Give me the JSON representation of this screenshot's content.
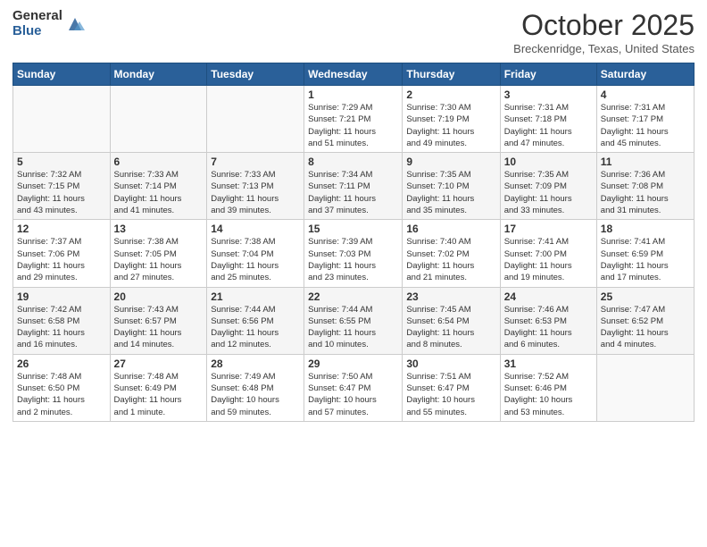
{
  "header": {
    "logo_general": "General",
    "logo_blue": "Blue",
    "month_title": "October 2025",
    "location": "Breckenridge, Texas, United States"
  },
  "days_of_week": [
    "Sunday",
    "Monday",
    "Tuesday",
    "Wednesday",
    "Thursday",
    "Friday",
    "Saturday"
  ],
  "weeks": [
    [
      {
        "day": "",
        "info": ""
      },
      {
        "day": "",
        "info": ""
      },
      {
        "day": "",
        "info": ""
      },
      {
        "day": "1",
        "info": "Sunrise: 7:29 AM\nSunset: 7:21 PM\nDaylight: 11 hours\nand 51 minutes."
      },
      {
        "day": "2",
        "info": "Sunrise: 7:30 AM\nSunset: 7:19 PM\nDaylight: 11 hours\nand 49 minutes."
      },
      {
        "day": "3",
        "info": "Sunrise: 7:31 AM\nSunset: 7:18 PM\nDaylight: 11 hours\nand 47 minutes."
      },
      {
        "day": "4",
        "info": "Sunrise: 7:31 AM\nSunset: 7:17 PM\nDaylight: 11 hours\nand 45 minutes."
      }
    ],
    [
      {
        "day": "5",
        "info": "Sunrise: 7:32 AM\nSunset: 7:15 PM\nDaylight: 11 hours\nand 43 minutes."
      },
      {
        "day": "6",
        "info": "Sunrise: 7:33 AM\nSunset: 7:14 PM\nDaylight: 11 hours\nand 41 minutes."
      },
      {
        "day": "7",
        "info": "Sunrise: 7:33 AM\nSunset: 7:13 PM\nDaylight: 11 hours\nand 39 minutes."
      },
      {
        "day": "8",
        "info": "Sunrise: 7:34 AM\nSunset: 7:11 PM\nDaylight: 11 hours\nand 37 minutes."
      },
      {
        "day": "9",
        "info": "Sunrise: 7:35 AM\nSunset: 7:10 PM\nDaylight: 11 hours\nand 35 minutes."
      },
      {
        "day": "10",
        "info": "Sunrise: 7:35 AM\nSunset: 7:09 PM\nDaylight: 11 hours\nand 33 minutes."
      },
      {
        "day": "11",
        "info": "Sunrise: 7:36 AM\nSunset: 7:08 PM\nDaylight: 11 hours\nand 31 minutes."
      }
    ],
    [
      {
        "day": "12",
        "info": "Sunrise: 7:37 AM\nSunset: 7:06 PM\nDaylight: 11 hours\nand 29 minutes."
      },
      {
        "day": "13",
        "info": "Sunrise: 7:38 AM\nSunset: 7:05 PM\nDaylight: 11 hours\nand 27 minutes."
      },
      {
        "day": "14",
        "info": "Sunrise: 7:38 AM\nSunset: 7:04 PM\nDaylight: 11 hours\nand 25 minutes."
      },
      {
        "day": "15",
        "info": "Sunrise: 7:39 AM\nSunset: 7:03 PM\nDaylight: 11 hours\nand 23 minutes."
      },
      {
        "day": "16",
        "info": "Sunrise: 7:40 AM\nSunset: 7:02 PM\nDaylight: 11 hours\nand 21 minutes."
      },
      {
        "day": "17",
        "info": "Sunrise: 7:41 AM\nSunset: 7:00 PM\nDaylight: 11 hours\nand 19 minutes."
      },
      {
        "day": "18",
        "info": "Sunrise: 7:41 AM\nSunset: 6:59 PM\nDaylight: 11 hours\nand 17 minutes."
      }
    ],
    [
      {
        "day": "19",
        "info": "Sunrise: 7:42 AM\nSunset: 6:58 PM\nDaylight: 11 hours\nand 16 minutes."
      },
      {
        "day": "20",
        "info": "Sunrise: 7:43 AM\nSunset: 6:57 PM\nDaylight: 11 hours\nand 14 minutes."
      },
      {
        "day": "21",
        "info": "Sunrise: 7:44 AM\nSunset: 6:56 PM\nDaylight: 11 hours\nand 12 minutes."
      },
      {
        "day": "22",
        "info": "Sunrise: 7:44 AM\nSunset: 6:55 PM\nDaylight: 11 hours\nand 10 minutes."
      },
      {
        "day": "23",
        "info": "Sunrise: 7:45 AM\nSunset: 6:54 PM\nDaylight: 11 hours\nand 8 minutes."
      },
      {
        "day": "24",
        "info": "Sunrise: 7:46 AM\nSunset: 6:53 PM\nDaylight: 11 hours\nand 6 minutes."
      },
      {
        "day": "25",
        "info": "Sunrise: 7:47 AM\nSunset: 6:52 PM\nDaylight: 11 hours\nand 4 minutes."
      }
    ],
    [
      {
        "day": "26",
        "info": "Sunrise: 7:48 AM\nSunset: 6:50 PM\nDaylight: 11 hours\nand 2 minutes."
      },
      {
        "day": "27",
        "info": "Sunrise: 7:48 AM\nSunset: 6:49 PM\nDaylight: 11 hours\nand 1 minute."
      },
      {
        "day": "28",
        "info": "Sunrise: 7:49 AM\nSunset: 6:48 PM\nDaylight: 10 hours\nand 59 minutes."
      },
      {
        "day": "29",
        "info": "Sunrise: 7:50 AM\nSunset: 6:47 PM\nDaylight: 10 hours\nand 57 minutes."
      },
      {
        "day": "30",
        "info": "Sunrise: 7:51 AM\nSunset: 6:47 PM\nDaylight: 10 hours\nand 55 minutes."
      },
      {
        "day": "31",
        "info": "Sunrise: 7:52 AM\nSunset: 6:46 PM\nDaylight: 10 hours\nand 53 minutes."
      },
      {
        "day": "",
        "info": ""
      }
    ]
  ]
}
